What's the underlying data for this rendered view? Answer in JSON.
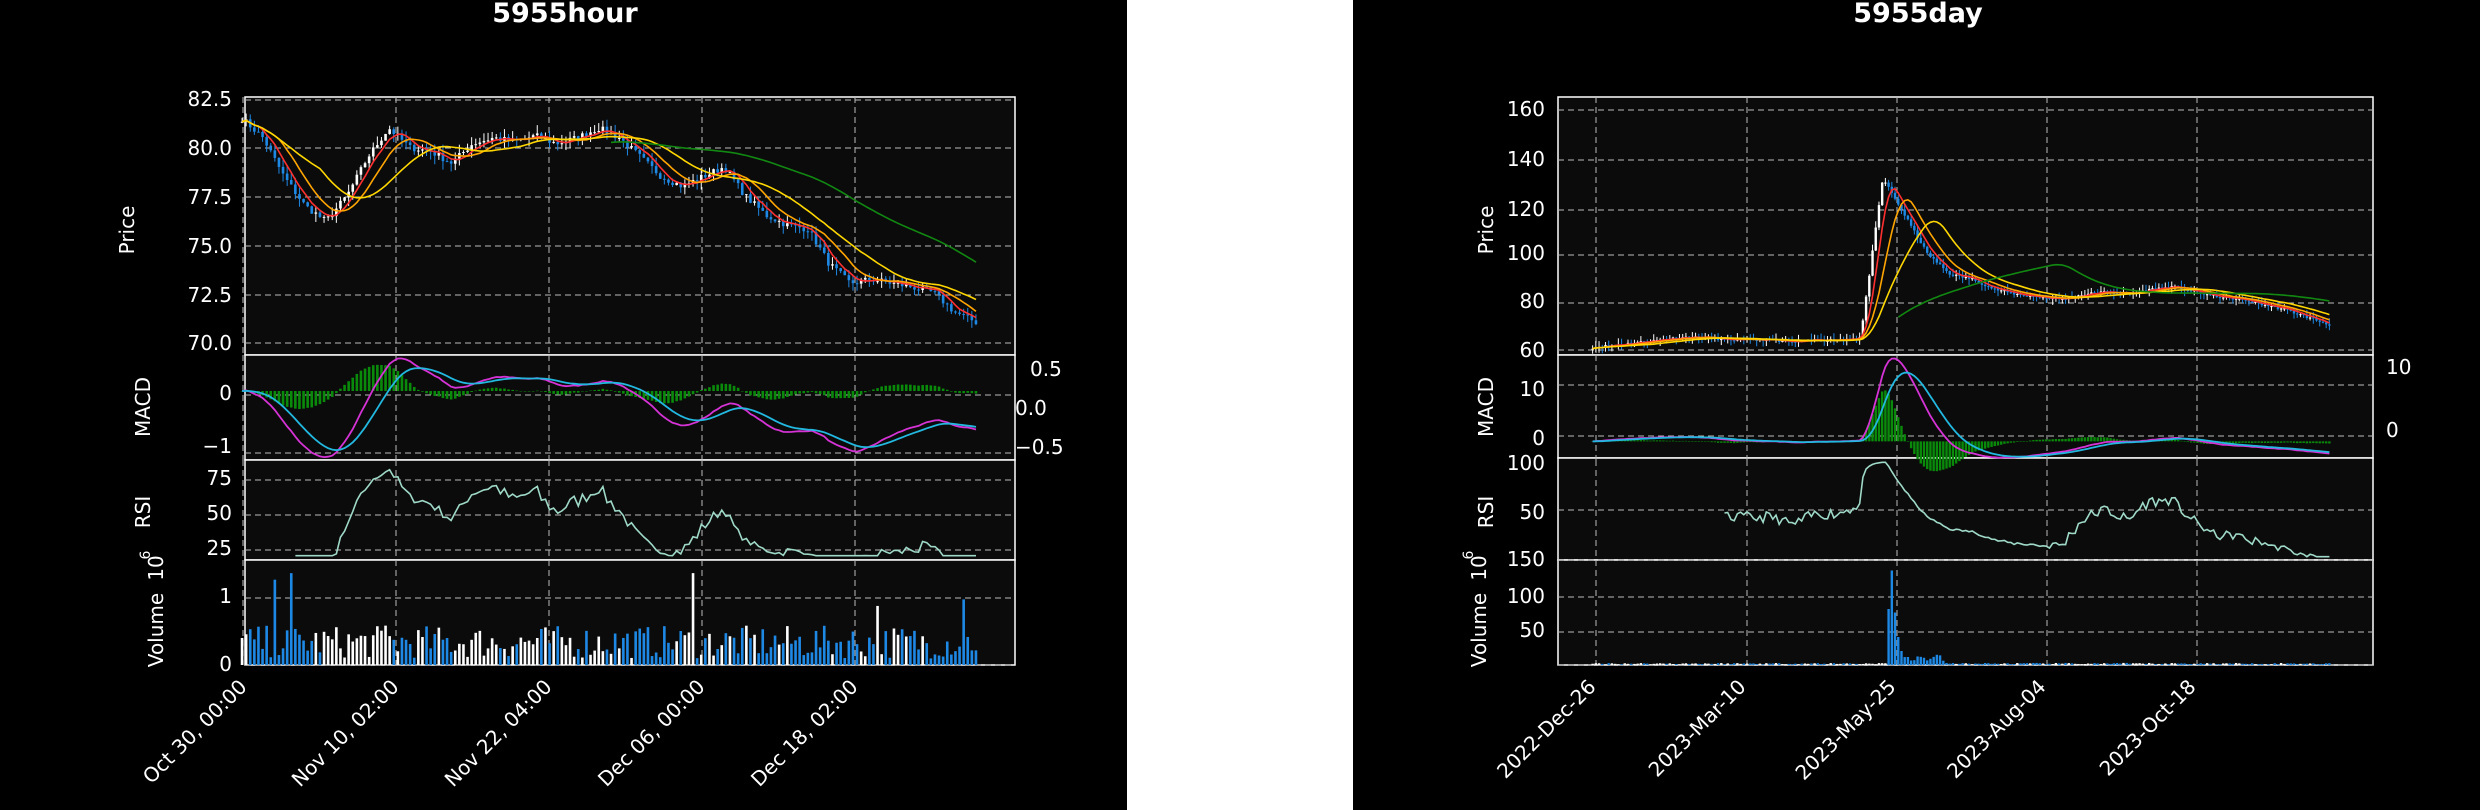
{
  "charts": {
    "hour": {
      "title": "5955hour",
      "price_label": "Price",
      "macd_label": "MACD",
      "rsi_label": "RSI",
      "volume_label": "Volume",
      "volume_exp": "10",
      "volume_exp_power": "6",
      "price_ticks": [
        "82.5",
        "80.0",
        "77.5",
        "75.0",
        "72.5",
        "70.0"
      ],
      "macd_left_ticks": [
        "0",
        "−1"
      ],
      "macd_right_ticks": [
        "0.5",
        "0.0",
        "−0.5"
      ],
      "rsi_ticks": [
        "75",
        "50",
        "25"
      ],
      "volume_ticks": [
        "1",
        "0"
      ],
      "x_ticks": [
        "Oct 30, 00:00",
        "Nov 10, 02:00",
        "Nov 22, 04:00",
        "Dec 06, 00:00",
        "Dec 18, 02:00"
      ]
    },
    "day": {
      "title": "5955day",
      "price_label": "Price",
      "macd_label": "MACD",
      "rsi_label": "RSI",
      "volume_label": "Volume",
      "volume_exp": "10",
      "volume_exp_power": "6",
      "price_ticks": [
        "160",
        "140",
        "120",
        "100",
        "80",
        "60"
      ],
      "macd_left_ticks": [
        "10",
        "0"
      ],
      "macd_right_ticks": [
        "10",
        "0"
      ],
      "rsi_ticks": [
        "100",
        "50"
      ],
      "volume_ticks": [
        "150",
        "100",
        "50"
      ],
      "x_ticks": [
        "2022-Dec-26",
        "2023-Mar-10",
        "2023-May-25",
        "2023-Aug-04",
        "2023-Oct-18"
      ]
    }
  },
  "chart_data": [
    {
      "type": "candlestick",
      "title": "5955hour",
      "ylabel": "Price",
      "ylim": [
        69.3,
        82.6
      ],
      "x_tick_labels": [
        "Oct 30, 00:00",
        "Nov 10, 02:00",
        "Nov 22, 04:00",
        "Dec 06, 00:00",
        "Dec 18, 02:00"
      ],
      "close_approx": [
        81.5,
        80.5,
        78.5,
        77.0,
        76.2,
        77.5,
        79.5,
        81.0,
        80.0,
        79.8,
        79.2,
        80.2,
        80.5,
        80.3,
        80.6,
        80.2,
        80.5,
        81.0,
        80.5,
        79.5,
        78.5,
        78.0,
        78.5,
        79.0,
        77.5,
        76.5,
        76.0,
        75.8,
        74.0,
        73.0,
        73.2,
        73.0,
        72.8,
        72.5,
        71.5,
        71.0
      ],
      "indicators": [
        "MA fast (red)",
        "MA mid (orange)",
        "MA slow (yellow)",
        "MA long (green)"
      ],
      "grid": true,
      "panels": [
        {
          "name": "MACD",
          "ylim_left": [
            -1.2,
            0.6
          ],
          "ylim_right": [
            -0.6,
            0.6
          ]
        },
        {
          "name": "RSI",
          "ylim": [
            15,
            85
          ]
        },
        {
          "name": "Volume",
          "unit": "10^6",
          "ylim": [
            0,
            1.6
          ]
        }
      ]
    },
    {
      "type": "candlestick",
      "title": "5955day",
      "ylabel": "Price",
      "ylim": [
        60,
        162
      ],
      "x_tick_labels": [
        "2022-Dec-26",
        "2023-Mar-10",
        "2023-May-25",
        "2023-Aug-04",
        "2023-Oct-18"
      ],
      "close_approx": [
        63,
        64,
        65,
        66,
        67,
        67,
        66,
        66,
        66,
        65,
        66,
        66,
        67,
        130,
        115,
        100,
        92,
        90,
        86,
        84,
        83,
        82,
        84,
        85,
        84,
        86,
        87,
        85,
        83,
        82,
        80,
        78,
        75,
        72
      ],
      "indicators": [
        "MA fast (red)",
        "MA mid (orange)",
        "MA slow (yellow)",
        "MA long (green)"
      ],
      "grid": true,
      "panels": [
        {
          "name": "MACD",
          "ylim_left": [
            -3,
            16
          ],
          "ylim_right": [
            -3,
            16
          ]
        },
        {
          "name": "RSI",
          "ylim": [
            10,
            100
          ]
        },
        {
          "name": "Volume",
          "unit": "10^6",
          "ylim": [
            0,
            150
          ]
        }
      ]
    }
  ]
}
